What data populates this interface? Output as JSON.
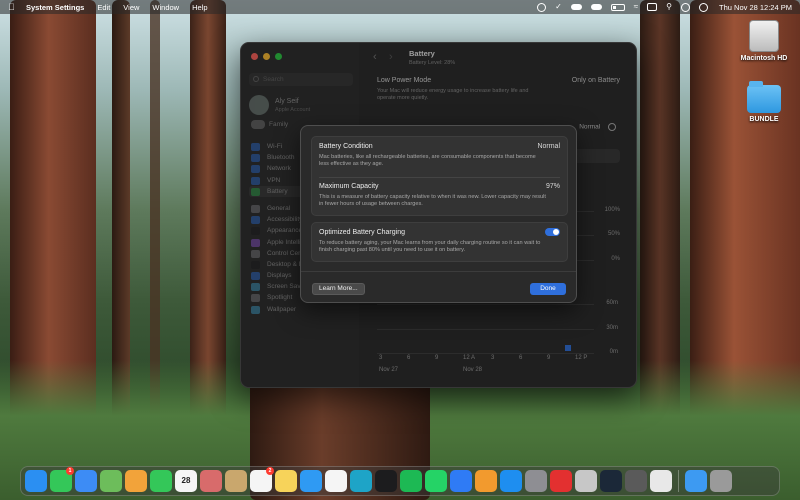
{
  "menubar": {
    "app_name": "System Settings",
    "menus": [
      "Edit",
      "View",
      "Window",
      "Help"
    ],
    "clock": "Thu Nov 28  12:24 PM"
  },
  "desktop": {
    "icons": [
      {
        "label": "Macintosh HD",
        "icon": "hard-drive-icon"
      },
      {
        "label": "BUNDLE",
        "icon": "folder-icon"
      }
    ]
  },
  "window": {
    "search_placeholder": "Search",
    "account": {
      "name": "Aly Seif",
      "subtitle": "Apple Account"
    },
    "family_label": "Family",
    "sidebar_items": [
      {
        "label": "Wi-Fi",
        "color": "#2f7bf5"
      },
      {
        "label": "Bluetooth",
        "color": "#2f7bf5"
      },
      {
        "label": "Network",
        "color": "#2f7bf5"
      },
      {
        "label": "VPN",
        "color": "#2f7bf5"
      },
      {
        "label": "Battery",
        "color": "#34c759",
        "selected": true
      },
      {
        "label": "General",
        "color": "#8e8e93",
        "group_start": true
      },
      {
        "label": "Accessibility",
        "color": "#2f7bf5"
      },
      {
        "label": "Appearance",
        "color": "#1c1c1e"
      },
      {
        "label": "Apple Intelligence",
        "color": "#a25ef0"
      },
      {
        "label": "Control Center",
        "color": "#8e8e93"
      },
      {
        "label": "Desktop & Dock",
        "color": "#1c1c1e"
      },
      {
        "label": "Displays",
        "color": "#2f7bf5"
      },
      {
        "label": "Screen Saver",
        "color": "#45b7e8"
      },
      {
        "label": "Spotlight",
        "color": "#8e8e93"
      },
      {
        "label": "Wallpaper",
        "color": "#45b7e8"
      }
    ],
    "title": "Battery",
    "subtitle": "Battery Level: 28%",
    "low_power": {
      "label": "Low Power Mode",
      "value": "Only on Battery",
      "description": "Your Mac will reduce energy usage to increase battery life and operate more quietly."
    },
    "battery_health_value": "Normal",
    "chart": {
      "pct_ticks": [
        "100%",
        "50%",
        "0%"
      ],
      "min_ticks": [
        "60m",
        "30m",
        "0m"
      ],
      "hour_ticks": [
        "3",
        "6",
        "9",
        "12 A",
        "3",
        "6",
        "9",
        "12 P"
      ],
      "dates": [
        "Nov 27",
        "Nov 28"
      ]
    }
  },
  "sheet": {
    "condition": {
      "title": "Battery Condition",
      "value": "Normal",
      "description": "Mac batteries, like all rechargeable batteries, are consumable components that become less effective as they age."
    },
    "capacity": {
      "title": "Maximum Capacity",
      "value": "97%",
      "description": "This is a measure of battery capacity relative to when it was new. Lower capacity may result in fewer hours of usage between charges."
    },
    "optimized": {
      "title": "Optimized Battery Charging",
      "enabled": true,
      "description": "To reduce battery aging, your Mac learns from your daily charging routine so it can wait to finish charging past 80% until you need to use it on battery."
    },
    "learn_more_label": "Learn More...",
    "done_label": "Done"
  },
  "dock": {
    "apps": [
      {
        "name": "finder-icon",
        "color": "#2b8ff2"
      },
      {
        "name": "messages-icon",
        "color": "#34c759",
        "badge": "1"
      },
      {
        "name": "mail-icon",
        "color": "#3d8cf5"
      },
      {
        "name": "maps-icon",
        "color": "#6dbd5b"
      },
      {
        "name": "photos-icon",
        "color": "#f2a33a"
      },
      {
        "name": "facetime-icon",
        "color": "#34c759"
      },
      {
        "name": "calendar-icon",
        "color": "#f5f5f5",
        "badge": "",
        "text": "28"
      },
      {
        "name": "launchpad-icon",
        "color": "#d86b6b"
      },
      {
        "name": "reminders-icon",
        "color": "#c9a76d"
      },
      {
        "name": "notes-icon",
        "color": "#f5f5f5",
        "badge": "2"
      },
      {
        "name": "stickies-icon",
        "color": "#f7d35a"
      },
      {
        "name": "safari-icon",
        "color": "#2f9af3"
      },
      {
        "name": "chrome-icon",
        "color": "#f5f5f5"
      },
      {
        "name": "edge-icon",
        "color": "#1ea4c7"
      },
      {
        "name": "tv-icon",
        "color": "#1c1c1e"
      },
      {
        "name": "spotify-icon",
        "color": "#1db954"
      },
      {
        "name": "whatsapp-icon",
        "color": "#25d366"
      },
      {
        "name": "keynote-icon",
        "color": "#2f7bf5"
      },
      {
        "name": "pages-icon",
        "color": "#f29a2e"
      },
      {
        "name": "app-store-icon",
        "color": "#1e8ef0"
      },
      {
        "name": "system-settings-icon",
        "color": "#8e8e93"
      },
      {
        "name": "acrobat-icon",
        "color": "#e33030"
      },
      {
        "name": "preview-icon",
        "color": "#c7c7c7"
      },
      {
        "name": "steam-icon",
        "color": "#1b2838"
      },
      {
        "name": "migration-icon",
        "color": "#5a5a5a"
      },
      {
        "name": "screenshot-icon",
        "color": "#e8e8e8"
      }
    ],
    "trailing": [
      {
        "name": "downloads-folder-icon",
        "color": "#3d9af2"
      },
      {
        "name": "trash-icon",
        "color": "#9a9a9a"
      }
    ]
  }
}
